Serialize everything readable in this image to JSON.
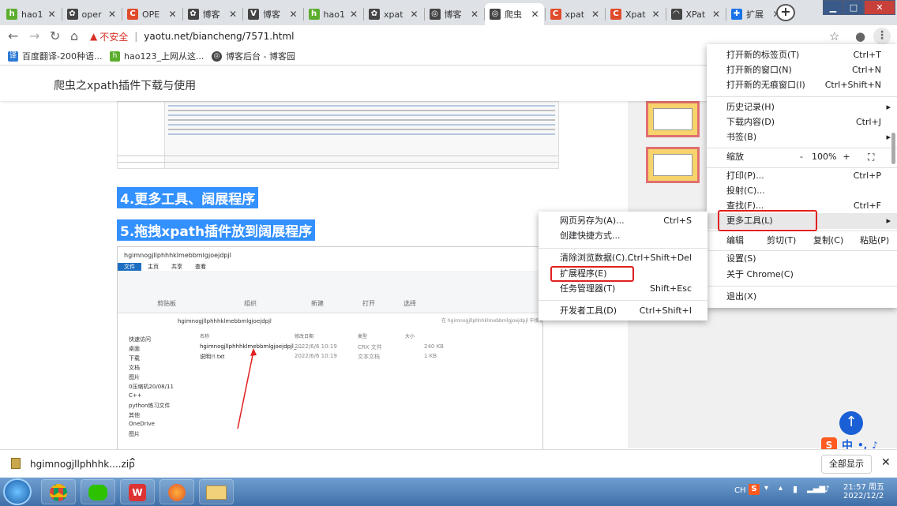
{
  "tabs": [
    {
      "label": "hao1",
      "icon": "hao-logo-icon",
      "color": "#5cae2e"
    },
    {
      "label": "oper",
      "icon": "settings-icon",
      "color": "#444"
    },
    {
      "label": "OPE",
      "icon": "csdn-c-icon",
      "color": "#e04b2c"
    },
    {
      "label": "博客",
      "icon": "settings-icon",
      "color": "#444"
    },
    {
      "label": "博客",
      "icon": "vue-icon",
      "color": "#444"
    },
    {
      "label": "hao1",
      "icon": "hao-logo-icon",
      "color": "#5cae2e"
    },
    {
      "label": "xpat",
      "icon": "settings-icon",
      "color": "#444"
    },
    {
      "label": "博客",
      "icon": "globe-icon",
      "color": "#444"
    },
    {
      "label": "爬虫",
      "icon": "globe-icon",
      "color": "#444"
    },
    {
      "label": "xpat",
      "icon": "csdn-c-icon",
      "color": "#e04b2c"
    },
    {
      "label": "Xpat",
      "icon": "csdn-c-icon",
      "color": "#e04b2c"
    },
    {
      "label": "XPat",
      "icon": "rainbow-icon",
      "color": "#444"
    },
    {
      "label": "扩展",
      "icon": "puzzle-icon",
      "color": "#1a73e8"
    }
  ],
  "address": {
    "insecure_label": "不安全",
    "url": "yaotu.net/biancheng/7571.html"
  },
  "bookmarks": [
    {
      "label": "百度翻译-200种语...",
      "icon": "translate-icon"
    },
    {
      "label": "hao123_上网从这...",
      "icon": "hao-logo-icon"
    },
    {
      "label": "博客后台 - 博客园",
      "icon": "globe-icon"
    }
  ],
  "page": {
    "title": "爬虫之xpath插件下载与使用",
    "heading4": "4.更多工具、阔展程序",
    "heading5": "5.拖拽xpath插件放到阔展程序"
  },
  "explorer": {
    "path_title": "hgimnogjllphhhklmebbmlgjoejdpjl",
    "tabs": [
      "文件",
      "主页",
      "共享",
      "查看"
    ],
    "groups": [
      "剪贴板",
      "组织",
      "新建",
      "打开",
      "选择"
    ],
    "breadcrumb": "hgimnogjllphhhklmebbmlgjoejdpjl",
    "search_placeholder": "在 hgimnogjllphhhklmebbmlgjoejdpjl 中搜索",
    "columns": [
      "名称",
      "修改日期",
      "类型",
      "大小"
    ],
    "files": [
      {
        "name": "hgimnogjllphhhklmebbmlgjoejdpjl_...",
        "date": "2022/6/6 10:19",
        "type": "CRX 文件",
        "size": "240 KB"
      },
      {
        "name": "说明!!.txt",
        "date": "2022/6/6 10:19",
        "type": "文本文档",
        "size": "1 KB"
      }
    ],
    "sidebar": [
      "快速访问",
      "桌面",
      "下载",
      "文档",
      "图片",
      "0压缩机20/08/11",
      "C++",
      "python练习文件",
      "其他",
      "OneDrive",
      "图片"
    ]
  },
  "menu": {
    "items": [
      {
        "label": "打开新的标签页(T)",
        "shortcut": "Ctrl+T"
      },
      {
        "label": "打开新的窗口(N)",
        "shortcut": "Ctrl+N"
      },
      {
        "label": "打开新的无痕窗口(I)",
        "shortcut": "Ctrl+Shift+N"
      },
      {
        "label": "历史记录(H)",
        "shortcut": ""
      },
      {
        "label": "下载内容(D)",
        "shortcut": "Ctrl+J"
      },
      {
        "label": "书签(B)",
        "shortcut": ""
      },
      {
        "label": "打印(P)...",
        "shortcut": "Ctrl+P"
      },
      {
        "label": "投射(C)...",
        "shortcut": ""
      },
      {
        "label": "查找(F)...",
        "shortcut": "Ctrl+F"
      },
      {
        "label": "更多工具(L)",
        "shortcut": ""
      },
      {
        "label": "设置(S)",
        "shortcut": ""
      },
      {
        "label": "关于 Chrome(C)",
        "shortcut": ""
      },
      {
        "label": "退出(X)",
        "shortcut": ""
      }
    ],
    "zoom": {
      "label": "缩放",
      "minus": "-",
      "value": "100%",
      "plus": "+"
    },
    "edit": {
      "label": "编辑",
      "cut": "剪切(T)",
      "copy": "复制(C)",
      "paste": "粘贴(P)"
    }
  },
  "submenu": {
    "items": [
      {
        "label": "网页另存为(A)...",
        "shortcut": "Ctrl+S"
      },
      {
        "label": "创建快捷方式...",
        "shortcut": ""
      },
      {
        "label": "清除浏览数据(C)...",
        "shortcut": "Ctrl+Shift+Del"
      },
      {
        "label": "扩展程序(E)",
        "shortcut": ""
      },
      {
        "label": "任务管理器(T)",
        "shortcut": "Shift+Esc"
      },
      {
        "label": "开发者工具(D)",
        "shortcut": "Ctrl+Shift+I"
      }
    ]
  },
  "download": {
    "file": "hgimnogjllphhhk....zip",
    "show_all": "全部显示"
  },
  "ime": {
    "lang": "中",
    "punct": "•,"
  },
  "taskbar": {
    "time": "21:57 周五",
    "date": "2022/12/2",
    "tray_lang": "CH"
  },
  "colors": {
    "accent_blue": "#3390ff",
    "highlight_red": "#e02020",
    "menu_hover": "#e8e8e8"
  }
}
